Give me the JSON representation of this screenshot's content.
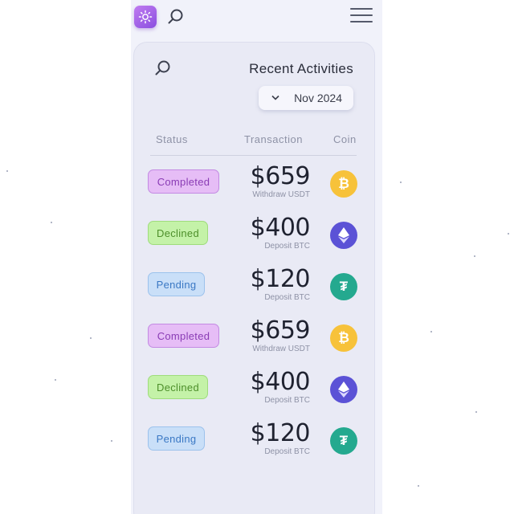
{
  "header": {
    "theme_icon": "sun-icon",
    "search_icon": "search-icon",
    "menu_icon": "hamburger-menu-icon"
  },
  "activities": {
    "title": "Recent Activities",
    "search_icon": "search-icon",
    "date_filter": {
      "value": "Nov 2024",
      "icon": "chevron-down-icon"
    },
    "columns": {
      "coin": "Coin",
      "transaction": "Transaction",
      "status": "Status"
    },
    "rows": [
      {
        "coin": "btc",
        "amount": "$659",
        "label": "Withdraw USDT",
        "status": "Completed"
      },
      {
        "coin": "eth",
        "amount": "$400",
        "label": "Deposit BTC",
        "status": "Declined"
      },
      {
        "coin": "usdt",
        "amount": "$120",
        "label": "Deposit BTC",
        "status": "Pending"
      },
      {
        "coin": "btc",
        "amount": "$659",
        "label": "Withdraw USDT",
        "status": "Completed"
      },
      {
        "coin": "eth",
        "amount": "$400",
        "label": "Deposit BTC",
        "status": "Declined"
      },
      {
        "coin": "usdt",
        "amount": "$120",
        "label": "Deposit BTC",
        "status": "Pending"
      }
    ]
  },
  "colors": {
    "accent": "#9b5de5",
    "completed": "#e6bdf6",
    "declined": "#c4f2a8",
    "pending": "#c9dff8",
    "btc": "#f7c23a",
    "eth": "#5b52d6",
    "usdt": "#24a98f"
  }
}
